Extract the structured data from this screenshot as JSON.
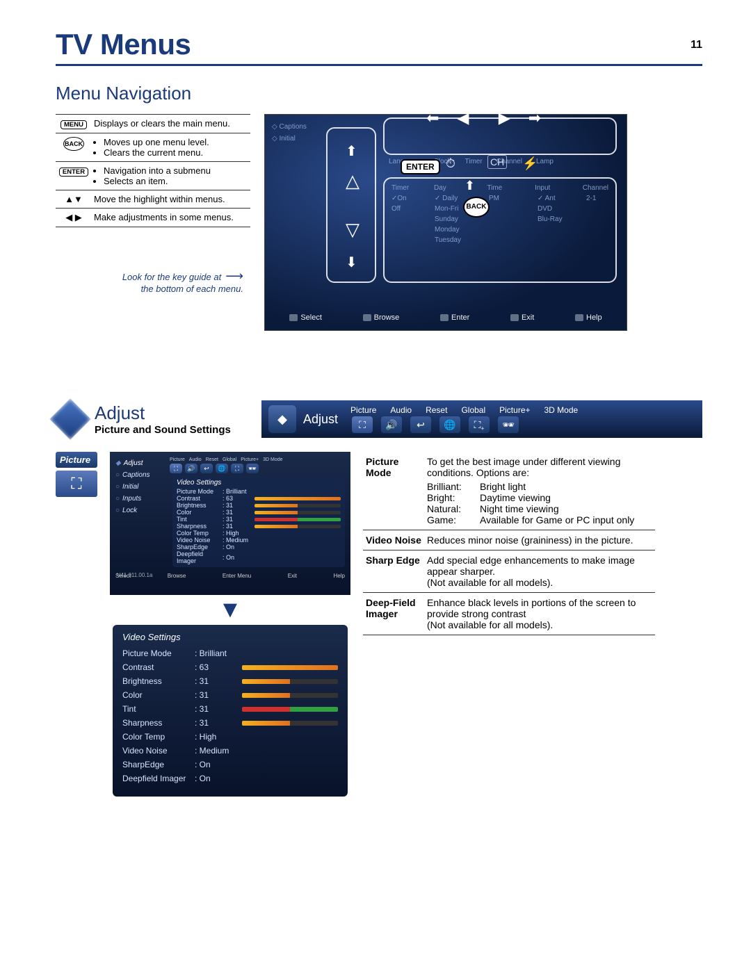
{
  "page_number": "11",
  "page_title": "TV Menus",
  "section_nav_title": "Menu Navigation",
  "nav_rows": {
    "menu": {
      "label": "MENU",
      "desc": "Displays or clears the main menu."
    },
    "back": {
      "label": "BACK",
      "b1": "Moves up one menu level.",
      "b2": "Clears the current menu."
    },
    "enter": {
      "label": "ENTER",
      "b1": "Navigation into a submenu",
      "b2": "Selects an item."
    },
    "updown": {
      "glyph": "▲▼",
      "desc": "Move the highlight within menus."
    },
    "leftright": {
      "glyph": "◀ ▶",
      "desc": "Make adjustments in some menus."
    }
  },
  "look_note_l1": "Look for the key guide at",
  "look_note_l2": "the bottom of each menu.",
  "tv_shot1": {
    "enter": "ENTER",
    "back": "BACK",
    "footer": [
      "Select",
      "Browse",
      "Enter",
      "Exit",
      "Help"
    ],
    "blur_headers": [
      "Timer",
      "Day",
      "Time",
      "Input",
      "Channel"
    ],
    "blur_cols_top": [
      "Captions",
      "Initial"
    ],
    "blur_row_labels": [
      "Language",
      "Clock",
      "Timer",
      "Channel",
      "Lamp"
    ],
    "blur_rows": [
      [
        "✓On",
        "✓ Daily",
        "PM",
        "✓ Ant",
        "2-1"
      ],
      [
        "Off",
        "Mon-Fri",
        "",
        "DVD",
        ""
      ],
      [
        "",
        "Sunday",
        "",
        "Blu-Ray",
        ""
      ],
      [
        "",
        "Monday",
        "",
        "",
        ""
      ],
      [
        "",
        "Tuesday",
        "",
        "",
        ""
      ]
    ]
  },
  "adjust": {
    "title": "Adjust",
    "subtitle": "Picture and Sound Settings",
    "bar_labels": [
      "Picture",
      "Audio",
      "Reset",
      "Global",
      "Picture+",
      "3D Mode"
    ],
    "bar_text": "Adjust"
  },
  "picture_badge": "Picture",
  "tv_shot2": {
    "left_items": [
      "Adjust",
      "Captions",
      "Initial",
      "Inputs",
      "Lock"
    ],
    "top_labels": [
      "Picture",
      "Audio",
      "Reset",
      "Global",
      "Picture+",
      "3D Mode"
    ],
    "version": "V41 011.00.1a",
    "footer": [
      "Select",
      "Browse",
      "Enter Menu",
      "Exit",
      "Help"
    ]
  },
  "video_settings": {
    "title": "Video Settings",
    "rows": [
      {
        "lbl": "Picture Mode",
        "val": "Brilliant",
        "pct": null
      },
      {
        "lbl": "Contrast",
        "val": "63",
        "pct": 100
      },
      {
        "lbl": "Brightness",
        "val": "31",
        "pct": 50
      },
      {
        "lbl": "Color",
        "val": "31",
        "pct": 50
      },
      {
        "lbl": "Tint",
        "val": "31",
        "pct": 50,
        "dual": true
      },
      {
        "lbl": "Sharpness",
        "val": "31",
        "pct": 50
      },
      {
        "lbl": "Color Temp",
        "val": "High",
        "pct": null
      },
      {
        "lbl": "Video Noise",
        "val": "Medium",
        "pct": null
      },
      {
        "lbl": "SharpEdge",
        "val": "On",
        "pct": null
      },
      {
        "lbl": "Deepfield Imager",
        "val": "On",
        "pct": null
      }
    ]
  },
  "desc": {
    "picture_mode_intro": "To get the best image under different viewing conditions. Options are:",
    "pm_term": "Picture Mode",
    "pm_opts": [
      [
        "Brilliant:",
        "Bright light"
      ],
      [
        "Bright:",
        "Daytime viewing"
      ],
      [
        "Natural:",
        "Night time viewing"
      ],
      [
        "Game:",
        "Available for Game or PC input only"
      ]
    ],
    "vn_term": "Video Noise",
    "vn_desc": "Reduces minor noise (graininess) in the picture.",
    "se_term": "Sharp Edge",
    "se_desc": "Add special edge enhancements to make image appear sharper.\n(Not available for all models).",
    "df_term": "Deep-Field Imager",
    "df_desc": "Enhance black levels in portions of the screen to provide strong contrast\n(Not available for all models)."
  }
}
